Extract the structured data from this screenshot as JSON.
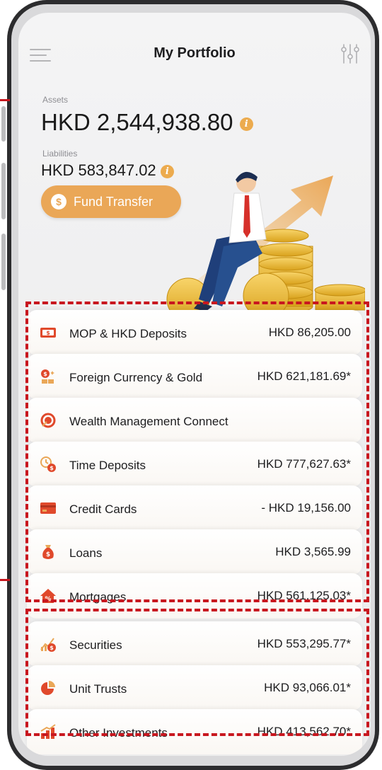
{
  "header": {
    "title": "My Portfolio"
  },
  "summary": {
    "assets_label": "Assets",
    "assets_value": "HKD 2,544,938.80",
    "liabilities_label": "Liabilities",
    "liabilities_value": "HKD 583,847.02",
    "info_glyph": "i"
  },
  "fund_transfer": {
    "label": "Fund Transfer",
    "icon_glyph": "$"
  },
  "accounts": [
    {
      "label": "MOP & HKD Deposits",
      "value": "HKD 86,205.00",
      "icon": "cash-icon"
    },
    {
      "label": "Foreign Currency & Gold",
      "value": "HKD 621,181.69*",
      "icon": "gold-coin-icon"
    },
    {
      "label": "Wealth Management Connect",
      "value": "",
      "icon": "wealth-connect-icon"
    },
    {
      "label": "Time Deposits",
      "value": "HKD 777,627.63*",
      "icon": "clock-coin-icon"
    },
    {
      "label": "Credit Cards",
      "value": "- HKD 19,156.00",
      "icon": "credit-card-icon"
    },
    {
      "label": "Loans",
      "value": "HKD 3,565.99",
      "icon": "money-bag-icon"
    },
    {
      "label": "Mortgages",
      "value": "HKD 561,125.03*",
      "icon": "house-percent-icon"
    }
  ],
  "investments": [
    {
      "label": "Securities",
      "value": "HKD 553,295.77*",
      "icon": "securities-chart-icon"
    },
    {
      "label": "Unit Trusts",
      "value": "HKD 93,066.01*",
      "icon": "pie-chart-icon"
    },
    {
      "label": "Other Investments",
      "value": "HKD 413,562.70*",
      "icon": "bar-chart-icon"
    }
  ],
  "colors": {
    "accent": "#eaa757",
    "icon_red": "#e0492b",
    "highlight_dash": "#c8171f"
  }
}
